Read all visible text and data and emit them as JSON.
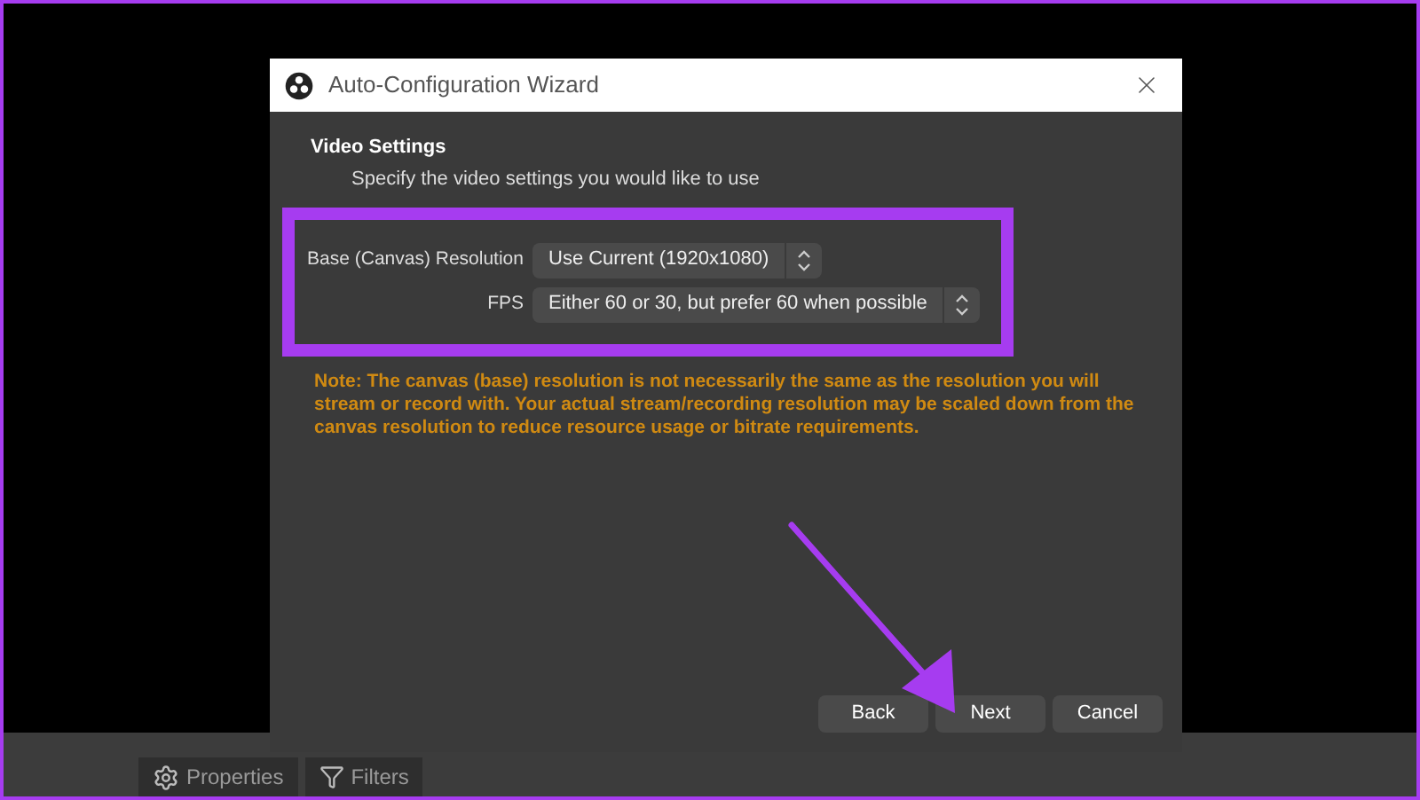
{
  "window": {
    "title": "Auto-Configuration Wizard"
  },
  "header": {
    "title": "Video Settings",
    "subtitle": "Specify the video settings you would like to use"
  },
  "fields": [
    {
      "label": "Base (Canvas) Resolution",
      "value": "Use Current (1920x1080)"
    },
    {
      "label": "FPS",
      "value": "Either 60 or 30, but prefer 60 when possible"
    }
  ],
  "note": "Note: The canvas (base) resolution is not necessarily the same as the resolution you will stream or record with. Your actual stream/recording resolution may be scaled down from the canvas resolution to reduce resource usage or bitrate requirements.",
  "buttons": [
    "Back",
    "Next",
    "Cancel"
  ],
  "background_tabs": [
    "Properties",
    "Filters"
  ]
}
